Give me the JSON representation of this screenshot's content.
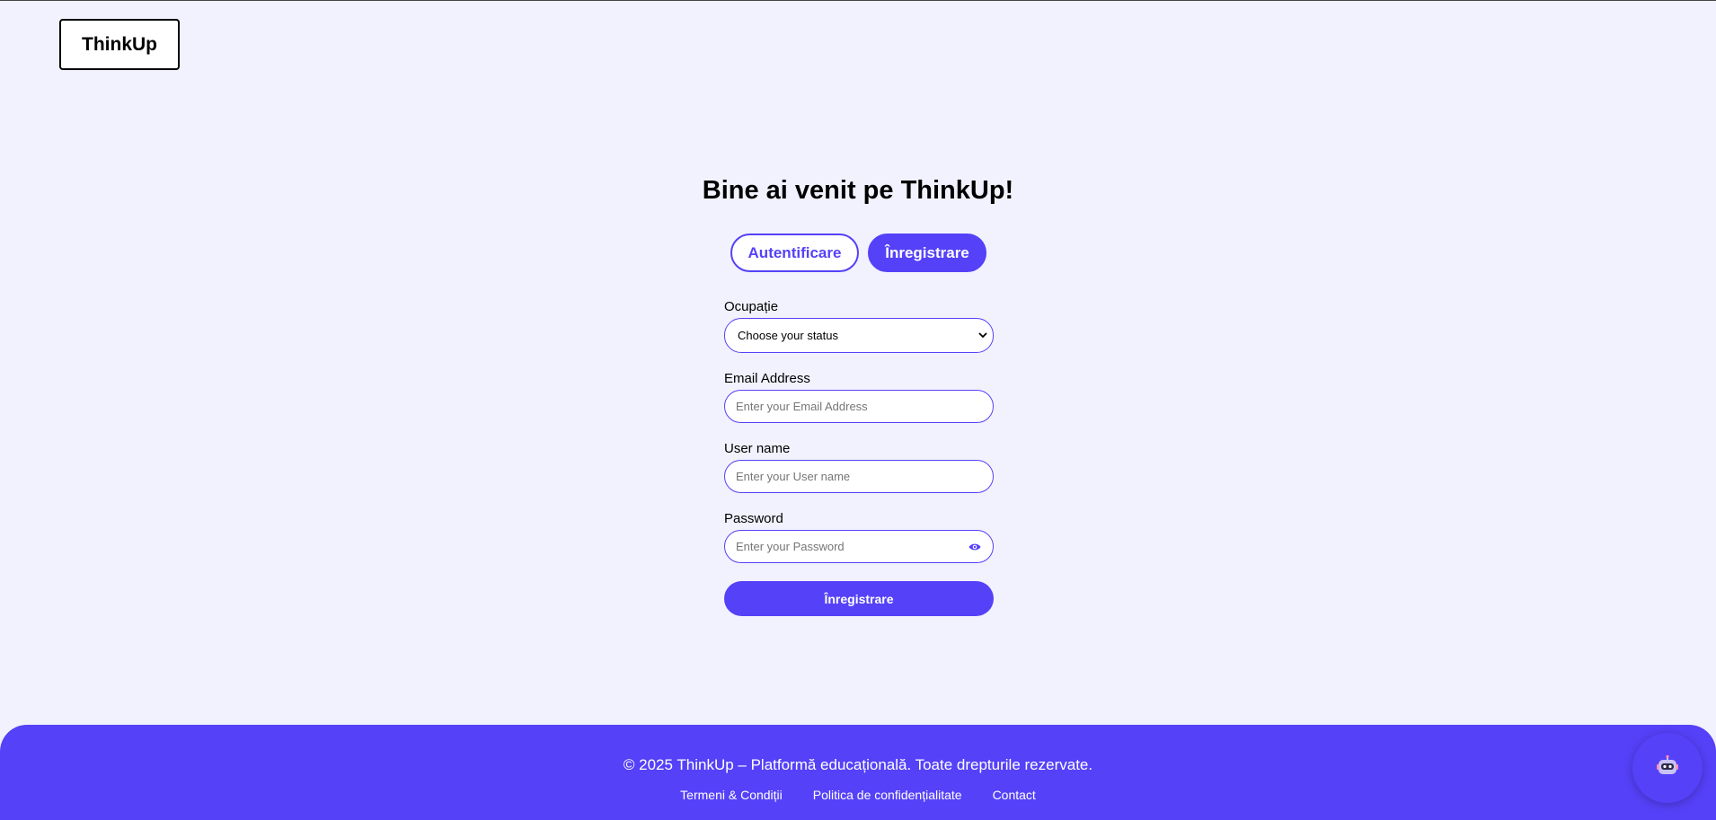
{
  "header": {
    "logo_text": "ThinkUp"
  },
  "main": {
    "title": "Bine ai venit pe ThinkUp!",
    "tabs": [
      {
        "label": "Autentificare",
        "active": false
      },
      {
        "label": "Înregistrare",
        "active": true
      }
    ],
    "form": {
      "occupation": {
        "label": "Ocupație",
        "selected": "Choose your status"
      },
      "email": {
        "label": "Email Address",
        "placeholder": "Enter your Email Address",
        "value": ""
      },
      "username": {
        "label": "User name",
        "placeholder": "Enter your User name",
        "value": ""
      },
      "password": {
        "label": "Password",
        "placeholder": "Enter your Password",
        "value": "",
        "toggle_icon": "eye-icon"
      },
      "submit_label": "Înregistrare"
    }
  },
  "footer": {
    "copyright": "© 2025 ThinkUp – Platformă educațională. Toate drepturile rezervate.",
    "links": [
      "Termeni & Condiții",
      "Politica de confidențialitate",
      "Contact"
    ]
  },
  "chatbot": {
    "icon": "robot-icon"
  },
  "colors": {
    "accent": "#5541f8",
    "background": "#f1f2fd",
    "white": "#ffffff"
  }
}
